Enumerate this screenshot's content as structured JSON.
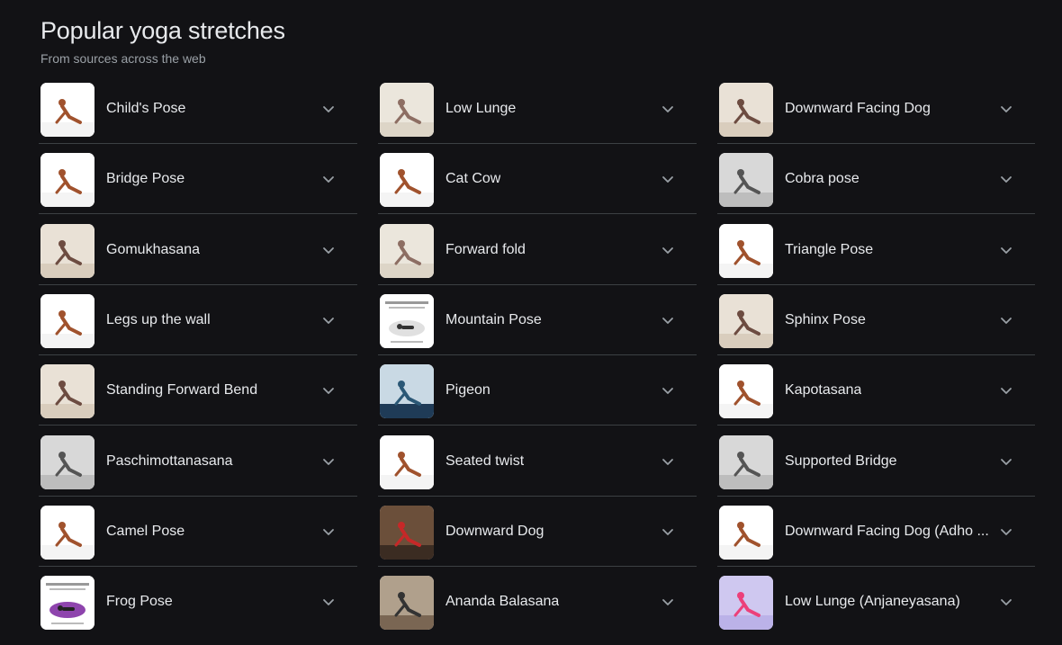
{
  "header": {
    "title": "Popular yoga stretches",
    "subtitle": "From sources across the web"
  },
  "columns": [
    {
      "items": [
        {
          "label": "Child's Pose",
          "thumb": "pose-photo-icon",
          "theme": "white"
        },
        {
          "label": "Bridge Pose",
          "thumb": "pose-photo-icon",
          "theme": "white"
        },
        {
          "label": "Gomukhasana",
          "thumb": "pose-photo-icon",
          "theme": "beige"
        },
        {
          "label": "Legs up the wall",
          "thumb": "pose-photo-icon",
          "theme": "white"
        },
        {
          "label": "Standing Forward Bend",
          "thumb": "pose-photo-icon",
          "theme": "beige"
        },
        {
          "label": "Paschimottanasana",
          "thumb": "pose-photo-icon",
          "theme": "grey"
        },
        {
          "label": "Camel Pose",
          "thumb": "pose-photo-icon",
          "theme": "white"
        },
        {
          "label": "Frog Pose",
          "thumb": "pose-diagram-icon",
          "theme": "purple"
        }
      ]
    },
    {
      "items": [
        {
          "label": "Low Lunge",
          "thumb": "pose-photo-icon",
          "theme": "arch"
        },
        {
          "label": "Cat Cow",
          "thumb": "pose-photo-icon",
          "theme": "white"
        },
        {
          "label": "Forward fold",
          "thumb": "pose-photo-icon",
          "theme": "arch"
        },
        {
          "label": "Mountain Pose",
          "thumb": "pose-diagram-icon",
          "theme": "chart"
        },
        {
          "label": "Pigeon",
          "thumb": "pose-photo-icon",
          "theme": "blue"
        },
        {
          "label": "Seated twist",
          "thumb": "pose-photo-icon",
          "theme": "white"
        },
        {
          "label": "Downward Dog",
          "thumb": "pose-photo-icon",
          "theme": "dark"
        },
        {
          "label": "Ananda Balasana",
          "thumb": "pose-photo-icon",
          "theme": "room"
        }
      ]
    },
    {
      "items": [
        {
          "label": "Downward Facing Dog",
          "thumb": "pose-photo-icon",
          "theme": "beige"
        },
        {
          "label": "Cobra pose",
          "thumb": "pose-photo-icon",
          "theme": "grey"
        },
        {
          "label": "Triangle Pose",
          "thumb": "pose-photo-icon",
          "theme": "white"
        },
        {
          "label": "Sphinx Pose",
          "thumb": "pose-photo-icon",
          "theme": "beige"
        },
        {
          "label": "Kapotasana",
          "thumb": "pose-photo-icon",
          "theme": "white"
        },
        {
          "label": "Supported Bridge",
          "thumb": "pose-photo-icon",
          "theme": "grey"
        },
        {
          "label": "Downward Facing Dog (Adho ...",
          "thumb": "pose-photo-icon",
          "theme": "white"
        },
        {
          "label": "Low Lunge (Anjaneyasana)",
          "thumb": "pose-photo-icon",
          "theme": "lavender"
        }
      ]
    }
  ],
  "colors": {
    "background": "#121215",
    "text": "#e8eaed",
    "subtext": "#9aa0a6",
    "divider": "#3c4043",
    "chevron": "#9aa0a6"
  },
  "icons": {
    "expand": "chevron-down-icon"
  }
}
